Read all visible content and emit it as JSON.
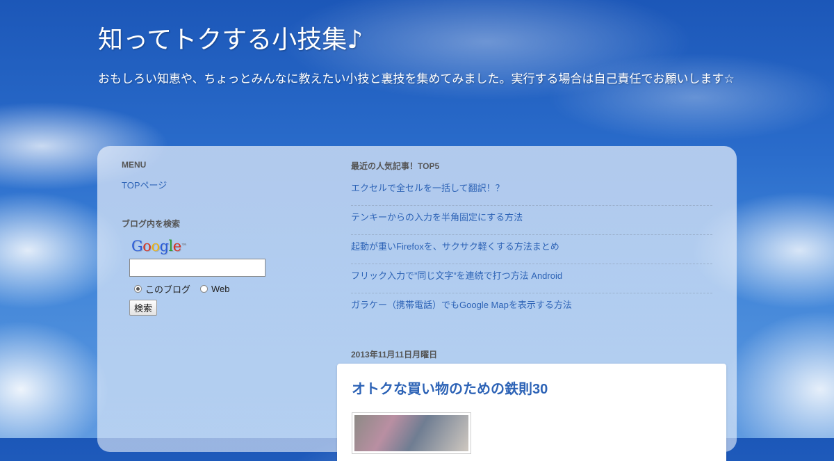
{
  "header": {
    "title": "知ってトクする小技集♪",
    "description": "おもしろい知恵や、ちょっとみんなに教えたい小技と裏技を集めてみました。実行する場合は自己責任でお願いします☆"
  },
  "sidebar": {
    "menu_title": "MENU",
    "menu_items": [
      {
        "label": "TOPページ"
      }
    ],
    "search": {
      "title": "ブログ内を検索",
      "logo_text": "Google",
      "input_value": "",
      "radio_options": [
        "このブログ",
        "Web"
      ],
      "selected": "このブログ",
      "button_label": "検索"
    }
  },
  "popular": {
    "title": "最近の人気記事！TOP5",
    "items": [
      "エクセルで全セルを一括して翻訳！？",
      "テンキーからの入力を半角固定にする方法",
      "起動が重いFirefoxを、サクサク軽くする方法まとめ",
      "フリック入力で”同じ文字”を連続で打つ方法 Android",
      "ガラケー（携帯電話）でもGoogle Mapを表示する方法"
    ]
  },
  "post": {
    "date": "2013年11月11日月曜日",
    "title": "オトクな買い物のための鉄則30"
  }
}
